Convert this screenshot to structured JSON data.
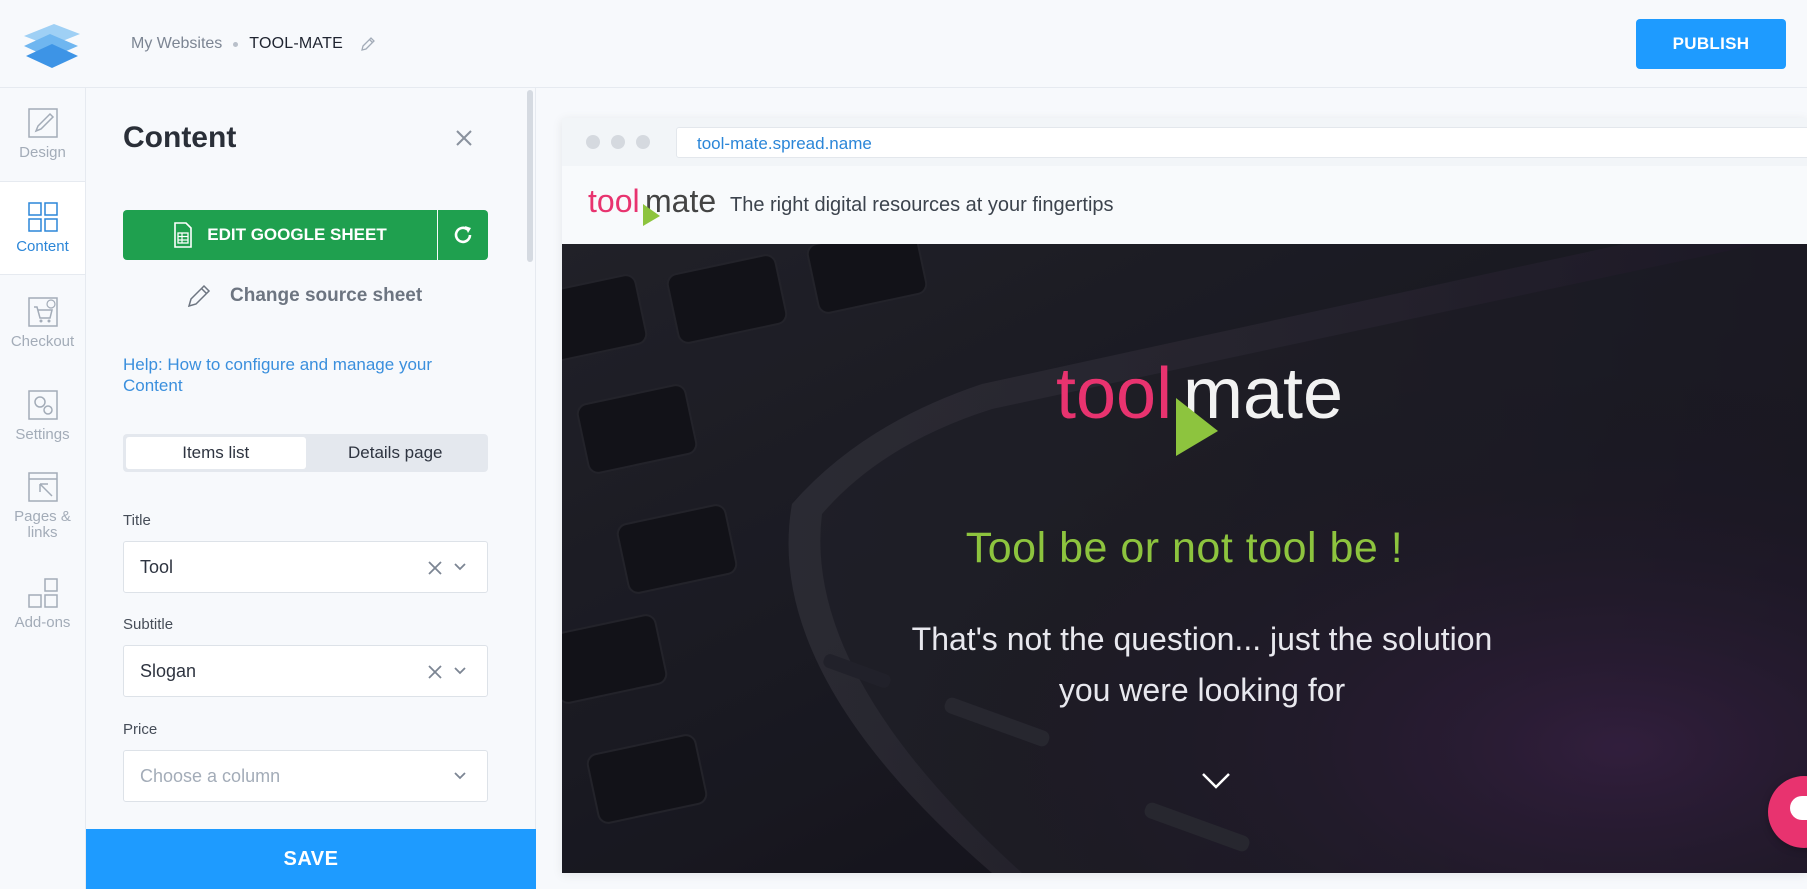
{
  "header": {
    "breadcrumb_root": "My Websites",
    "breadcrumb_current": "TOOL-MATE",
    "publish_label": "PUBLISH"
  },
  "rail": {
    "items": [
      {
        "label": "Design",
        "icon": "design-brush-icon"
      },
      {
        "label": "Content",
        "icon": "grid-icon",
        "active": true
      },
      {
        "label": "Checkout",
        "icon": "cart-icon"
      },
      {
        "label": "Settings",
        "icon": "gear-icon"
      },
      {
        "label": "Pages & links",
        "icon": "pages-icon"
      },
      {
        "label": "Add-ons",
        "icon": "addons-icon"
      }
    ]
  },
  "panel": {
    "title": "Content",
    "edit_sheet_label": "EDIT GOOGLE SHEET",
    "change_source_label": "Change source sheet",
    "help_link": "Help: How to configure and manage your Content",
    "tabs": [
      {
        "label": "Items list",
        "active": true
      },
      {
        "label": "Details page",
        "active": false
      }
    ],
    "fields": [
      {
        "label": "Title",
        "value": "Tool",
        "placeholder": ""
      },
      {
        "label": "Subtitle",
        "value": "Slogan",
        "placeholder": ""
      },
      {
        "label": "Price",
        "value": "",
        "placeholder": "Choose a column"
      }
    ],
    "save_label": "SAVE"
  },
  "preview": {
    "url": "tool-mate.spread.name",
    "tagline": "The right digital resources at your fingertips",
    "hero_title": "Tool be or not tool be !",
    "hero_subtitle_line1": "That's not the question... just the solution",
    "hero_subtitle_line2": "you were looking for",
    "brand_parts": [
      "tool",
      "mate"
    ]
  },
  "colors": {
    "accent_blue": "#1e9bff",
    "sheet_green": "#1fa04f",
    "brand_pink": "#e8336f",
    "brand_green": "#8dc43e"
  }
}
